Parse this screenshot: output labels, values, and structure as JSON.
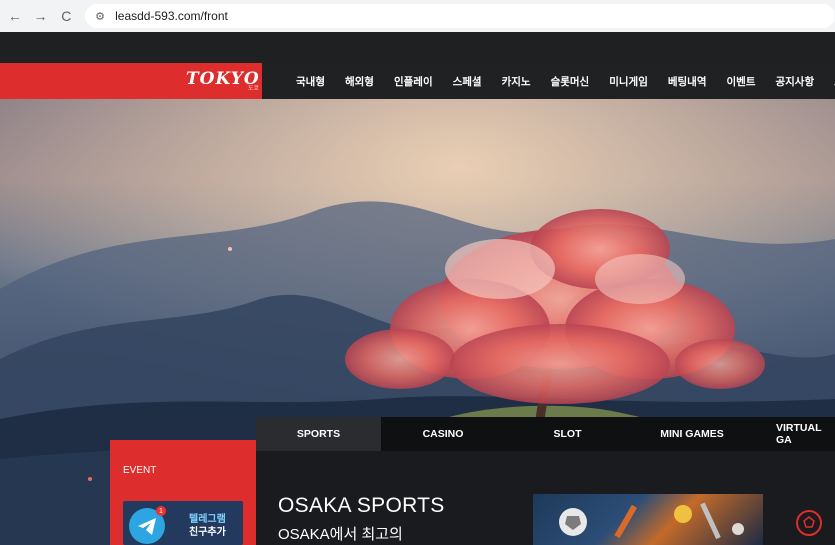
{
  "browser": {
    "url": "leasdd-593.com/front",
    "back_icon": "←",
    "forward_icon": "→",
    "reload_icon": "C",
    "tune_icon": "⚙"
  },
  "brand": {
    "logo_text": "TOKYO",
    "logo_sub": "도쿄",
    "accent": "#de2d2d"
  },
  "menu": {
    "items": [
      "국내형",
      "해외형",
      "인플레이",
      "스페셜",
      "카지노",
      "슬롯머신",
      "미니게임",
      "베팅내역",
      "이벤트",
      "공지사항",
      "고"
    ]
  },
  "tabs": {
    "items": [
      "SPORTS",
      "CASINO",
      "SLOT",
      "MINI GAMES",
      "VIRTUAL GA"
    ]
  },
  "event": {
    "label": "EVENT",
    "telegram_line1": "텔레그램",
    "telegram_line2": "친구추가",
    "badge": "1"
  },
  "osaka": {
    "title": "OSAKA SPORTS",
    "subtitle": "OSAKA에서 최고의"
  }
}
